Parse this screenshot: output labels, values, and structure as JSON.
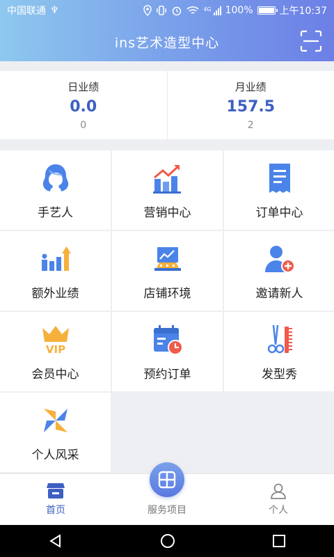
{
  "status_bar": {
    "carrier": "中国联通",
    "usb_symbol": "♆",
    "signal_label": "4G",
    "battery": "100%",
    "time": "上午10:37"
  },
  "header": {
    "title": "ins艺术造型中心",
    "scan_icon": "scan-icon"
  },
  "stats": [
    {
      "label": "日业绩",
      "value": "0.0",
      "count": "0"
    },
    {
      "label": "月业绩",
      "value": "157.5",
      "count": "2"
    }
  ],
  "menu": [
    {
      "label": "手艺人",
      "icon": "stylist-icon"
    },
    {
      "label": "营销中心",
      "icon": "marketing-chart-icon"
    },
    {
      "label": "订单中心",
      "icon": "order-receipt-icon"
    },
    {
      "label": "额外业绩",
      "icon": "extra-performance-icon"
    },
    {
      "label": "店铺环境",
      "icon": "store-environment-icon"
    },
    {
      "label": "邀请新人",
      "icon": "invite-user-icon"
    },
    {
      "label": "会员中心",
      "icon": "vip-crown-icon"
    },
    {
      "label": "预约订单",
      "icon": "calendar-clock-icon"
    },
    {
      "label": "发型秀",
      "icon": "scissors-comb-icon"
    },
    {
      "label": "个人风采",
      "icon": "pinwheel-icon"
    }
  ],
  "tabs": [
    {
      "label": "首页",
      "icon": "home-store-icon",
      "active": true
    },
    {
      "label": "服务项目",
      "icon": "grid-icon",
      "active": false
    },
    {
      "label": "个人",
      "icon": "person-icon",
      "active": false
    }
  ],
  "colors": {
    "accent": "#3e5fc2",
    "icon_blue": "#4a84e8",
    "icon_orange": "#f6b03c",
    "icon_red": "#ef5a4a"
  }
}
